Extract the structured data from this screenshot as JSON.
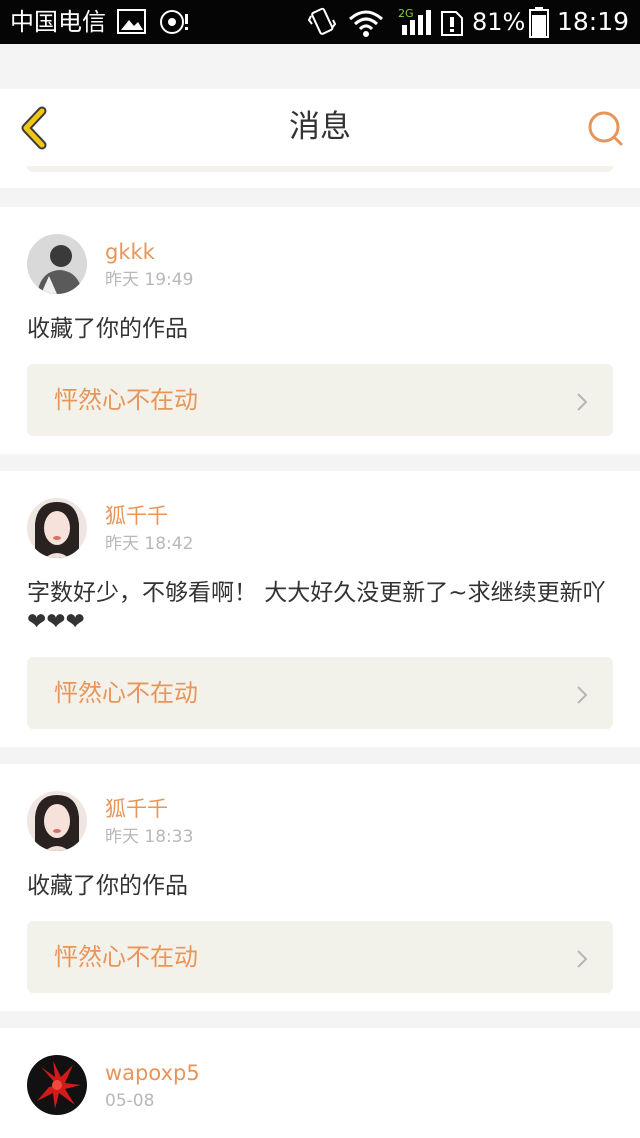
{
  "status_bar": {
    "carrier": "中国电信",
    "network": "2G",
    "battery": "81%",
    "time": "18:19"
  },
  "header": {
    "title": "消息"
  },
  "icons": {
    "back": "chevron-left-icon",
    "search": "search-icon",
    "arrow": "chevron-right-icon"
  },
  "colors": {
    "accent": "#e8955a",
    "back_icon": "#f2c615",
    "card_box": "#f3f2ea"
  },
  "messages": [
    {
      "username": "gkkk",
      "time": "昨天 19:49",
      "content": "收藏了你的作品",
      "work": "怦然心不在动"
    },
    {
      "username": "狐千千",
      "time": "昨天 18:42",
      "content": "字数好少，不够看啊！ 大大好久没更新了~求继续更新吖❤❤❤",
      "work": "怦然心不在动"
    },
    {
      "username": "狐千千",
      "time": "昨天 18:33",
      "content": "收藏了你的作品",
      "work": "怦然心不在动"
    },
    {
      "username": "wapoxp5",
      "time": "05-08"
    }
  ]
}
